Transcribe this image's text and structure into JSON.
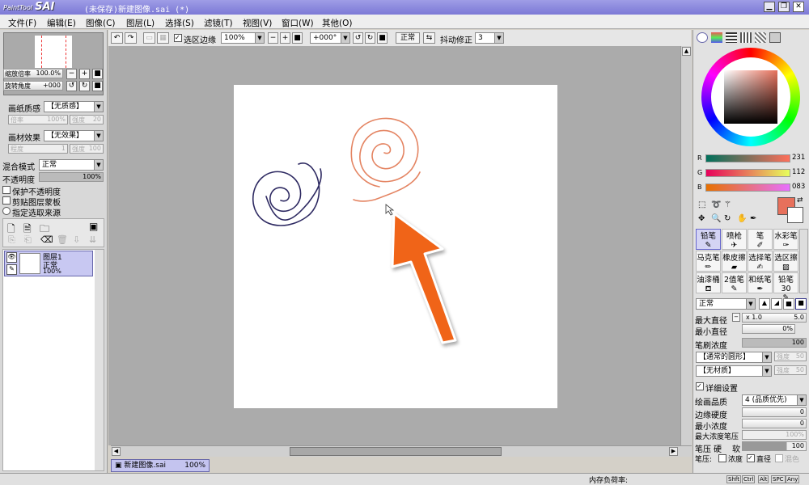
{
  "app": {
    "logo_small": "PaintTool",
    "logo_big": "SAI",
    "title": "(未保存)新建图像.sai (*)"
  },
  "menu": [
    "文件(F)",
    "编辑(E)",
    "图像(C)",
    "图层(L)",
    "选择(S)",
    "滤镜(T)",
    "视图(V)",
    "窗口(W)",
    "其他(O)"
  ],
  "toolbar": {
    "selection_edge": "选区边缘",
    "zoom": "100%",
    "rotation": "+000°",
    "normal_button": "正常",
    "stabilizer_label": "抖动修正",
    "stabilizer_value": "3"
  },
  "navigator": {
    "zoom_label": "缩放倍率",
    "zoom_value": "100.0%",
    "rotate_label": "旋转角度",
    "rotate_value": "+000"
  },
  "paper": {
    "texture_label": "画纸质感",
    "texture_value": "【无质感】",
    "texture_scale_label": "倍率",
    "texture_scale_value": "100%",
    "texture_strength_label": "强度",
    "texture_strength_value": "20",
    "effect_label": "画材效果",
    "effect_value": "【无效果】",
    "effect_level_label": "程度",
    "effect_level_value": "1",
    "effect_strength_label": "强度",
    "effect_strength_value": "100"
  },
  "layer_props": {
    "blend_label": "混合模式",
    "blend_value": "正常",
    "opacity_label": "不透明度",
    "opacity_value": "100%",
    "protect_opacity": "保护不透明度",
    "clip_group": "剪贴图层蒙板",
    "selection_source": "指定选取来源"
  },
  "layers": [
    {
      "name": "图层1",
      "mode": "正常",
      "opacity": "100%"
    }
  ],
  "colors": {
    "r_label": "R",
    "r": "231",
    "g_label": "G",
    "g": "112",
    "b_label": "B",
    "b": "083",
    "primary": "#e7705b",
    "spiral_left": "#2e2a62",
    "spiral_right": "#e48462",
    "arrow": "#f06418"
  },
  "tools": [
    "铅笔",
    "喷枪",
    "笔",
    "水彩笔",
    "马克笔",
    "橡皮擦",
    "选择笔",
    "选区擦",
    "油漆桶",
    "2值笔",
    "和纸笔",
    "铅笔30"
  ],
  "brush": {
    "mode": "正常",
    "max_size_label": "最大直径",
    "max_size_mult": "x 1.0",
    "max_size_value": "5.0",
    "min_size_label": "最小直径",
    "min_size_value": "0%",
    "density_label": "笔刷浓度",
    "density_value": "100",
    "shape": "【通常的圆形】",
    "shape_strength_label": "强度",
    "shape_strength_value": "50",
    "texture": "【无材质】",
    "texture_strength_label": "强度",
    "texture_strength_value": "50",
    "detail_settings": "详细设置",
    "quality_label": "绘画品质",
    "quality_value": "4 (品质优先)",
    "edge_hardness_label": "边缘硬度",
    "edge_hardness_value": "0",
    "min_density_label": "最小浓度",
    "min_density_value": "0",
    "max_pressure_label": "最大浓度笔压",
    "max_pressure_value": "100%",
    "pressure_label": "笔压",
    "pressure_hard": "硬",
    "pressure_soft": "软",
    "pressure_value": "100",
    "pressure_opts_label": "笔压:",
    "pressure_density": "浓度",
    "pressure_size": "直径",
    "pressure_blend": "混色"
  },
  "document_tab": {
    "name": "新建图像.sai",
    "zoom": "100%"
  },
  "status": {
    "memory_label": "内存负荷率:",
    "keys": [
      "Shft",
      "Ctrl",
      "Alt",
      "SPC",
      "Any"
    ]
  }
}
